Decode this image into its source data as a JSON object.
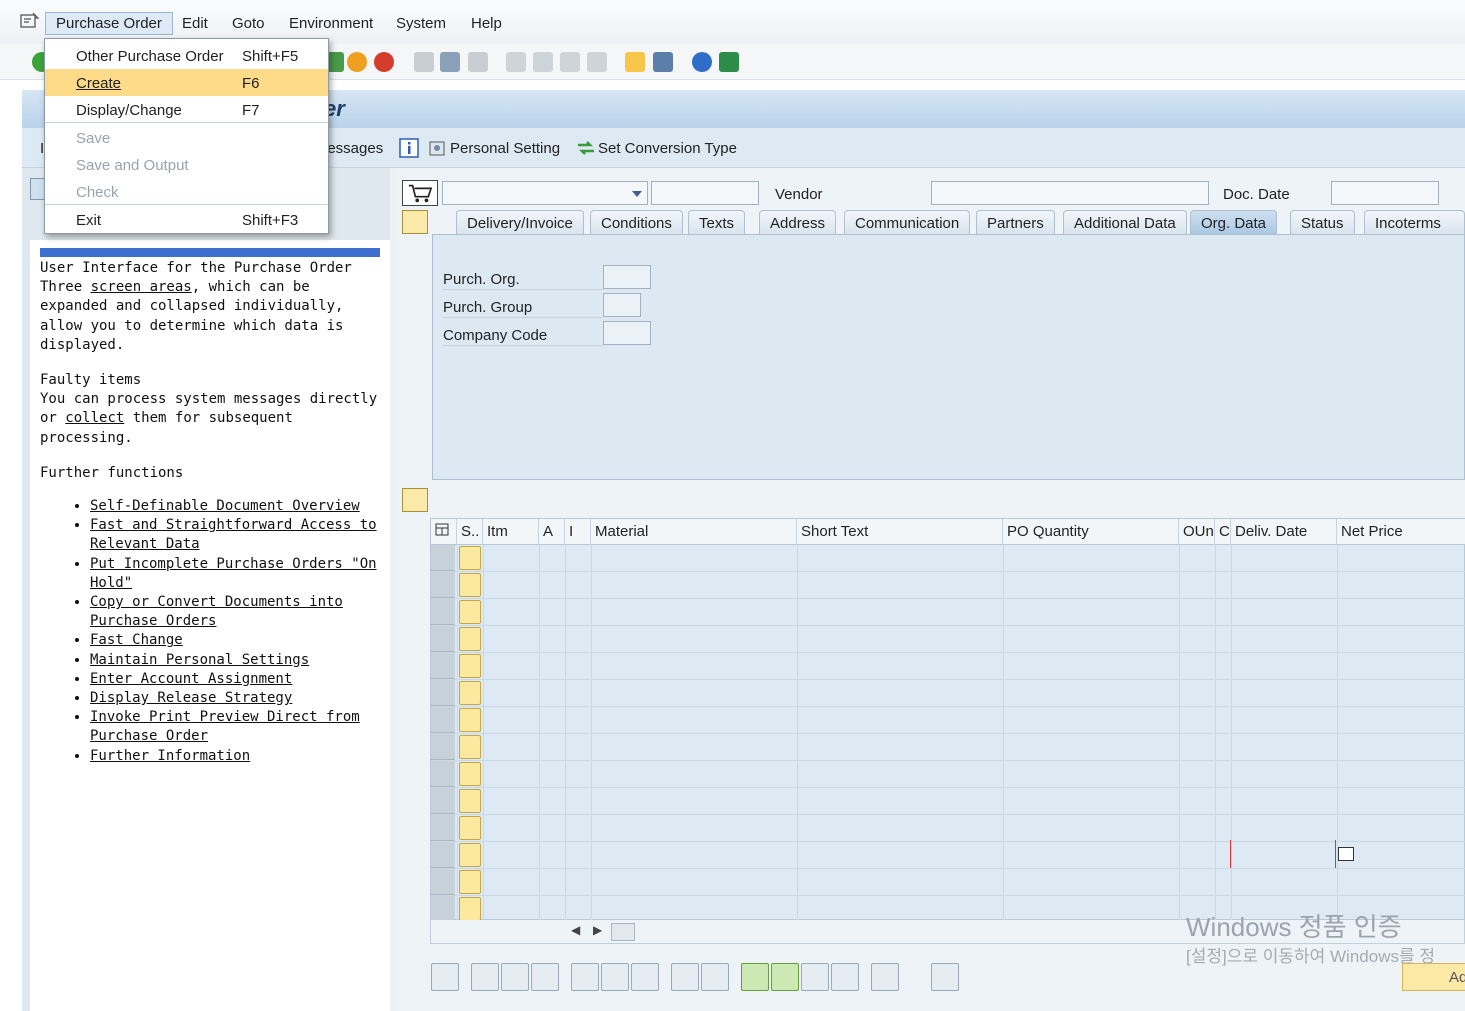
{
  "menubar": {
    "items": [
      "Purchase Order",
      "Edit",
      "Goto",
      "Environment",
      "System",
      "Help"
    ]
  },
  "dropdown": {
    "items": [
      {
        "label": "Other Purchase Order",
        "shortcut": "Shift+F5"
      },
      {
        "label": "Create",
        "shortcut": "F6"
      },
      {
        "label": "Display/Change",
        "shortcut": "F7"
      },
      {
        "label": "Save",
        "shortcut": ""
      },
      {
        "label": "Save and Output",
        "shortcut": ""
      },
      {
        "label": "Check",
        "shortcut": ""
      },
      {
        "label": "Exit",
        "shortcut": "Shift+F3"
      }
    ]
  },
  "title": {
    "text": "rder"
  },
  "apptoolbar": {
    "first_char": "I",
    "messages": "lessages",
    "personal_setting": "Personal Setting",
    "set_conversion": "Set Conversion Type"
  },
  "help": {
    "section1_title": "User Interface for the Purchase Order",
    "section1_text_a": "Three ",
    "section1_link": "screen areas",
    "section1_text_b": ", which can be expanded and collapsed individually, allow you to determine which data is displayed.",
    "section2_title": "Faulty items",
    "section2_text_a": "You can process system messages directly or ",
    "section2_link": "collect",
    "section2_text_b": " them for subsequent processing.",
    "section3_title": "Further functions",
    "links": [
      "Self-Definable Document Overview",
      "Fast and Straightforward Access to Relevant Data",
      "Put Incomplete Purchase Orders \"On Hold\"",
      "Copy or Convert Documents into Purchase Orders",
      "Fast Change",
      "Maintain Personal Settings",
      "Enter Account Assignment",
      "Display Release Strategy",
      "Invoke Print Preview Direct from Purchase Order",
      "Further Information"
    ]
  },
  "header": {
    "vendor_label": "Vendor",
    "doc_date_label": "Doc. Date"
  },
  "tabs": [
    "Delivery/Invoice",
    "Conditions",
    "Texts",
    "Address",
    "Communication",
    "Partners",
    "Additional Data",
    "Org. Data",
    "Status",
    "Incoterms"
  ],
  "org": {
    "purch_org": "Purch. Org.",
    "purch_group": "Purch. Group",
    "company_code": "Company Code"
  },
  "table": {
    "columns": [
      "S..",
      "Itm",
      "A",
      "I",
      "Material",
      "Short Text",
      "PO Quantity",
      "OUn",
      "C",
      "Deliv. Date",
      "Net Price"
    ]
  },
  "watermark": {
    "line1": "Windows 정품 인증",
    "line2": "[설정]으로 이동하여 Windows를 정",
    "button": "Ad"
  },
  "colors": {
    "menu_highlight": "#fddb89",
    "title_text": "#1d3e66",
    "help_bar": "#3c6fd0"
  }
}
